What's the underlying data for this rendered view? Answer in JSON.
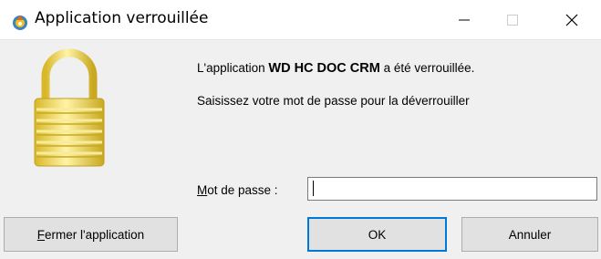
{
  "window": {
    "title": "Application verrouillée",
    "app_icon": "lock-app-icon",
    "controls": {
      "minimize": "minimize-icon",
      "maximize": "maximize-icon",
      "close": "close-icon"
    }
  },
  "message": {
    "line1_prefix": "L'application ",
    "app_name": "WD HC DOC CRM",
    "line1_suffix": " a été verrouillée.",
    "line2": "Saisissez votre mot de passe pour la déverrouiller"
  },
  "password": {
    "label_accel": "M",
    "label_rest": "ot de passe :",
    "value": "",
    "placeholder": ""
  },
  "buttons": {
    "close_app_accel": "F",
    "close_app_rest": "ermer l'application",
    "ok": "OK",
    "cancel": "Annuler"
  },
  "colors": {
    "lock_gold": "#f2d94c",
    "focus_border": "#0078d7"
  }
}
